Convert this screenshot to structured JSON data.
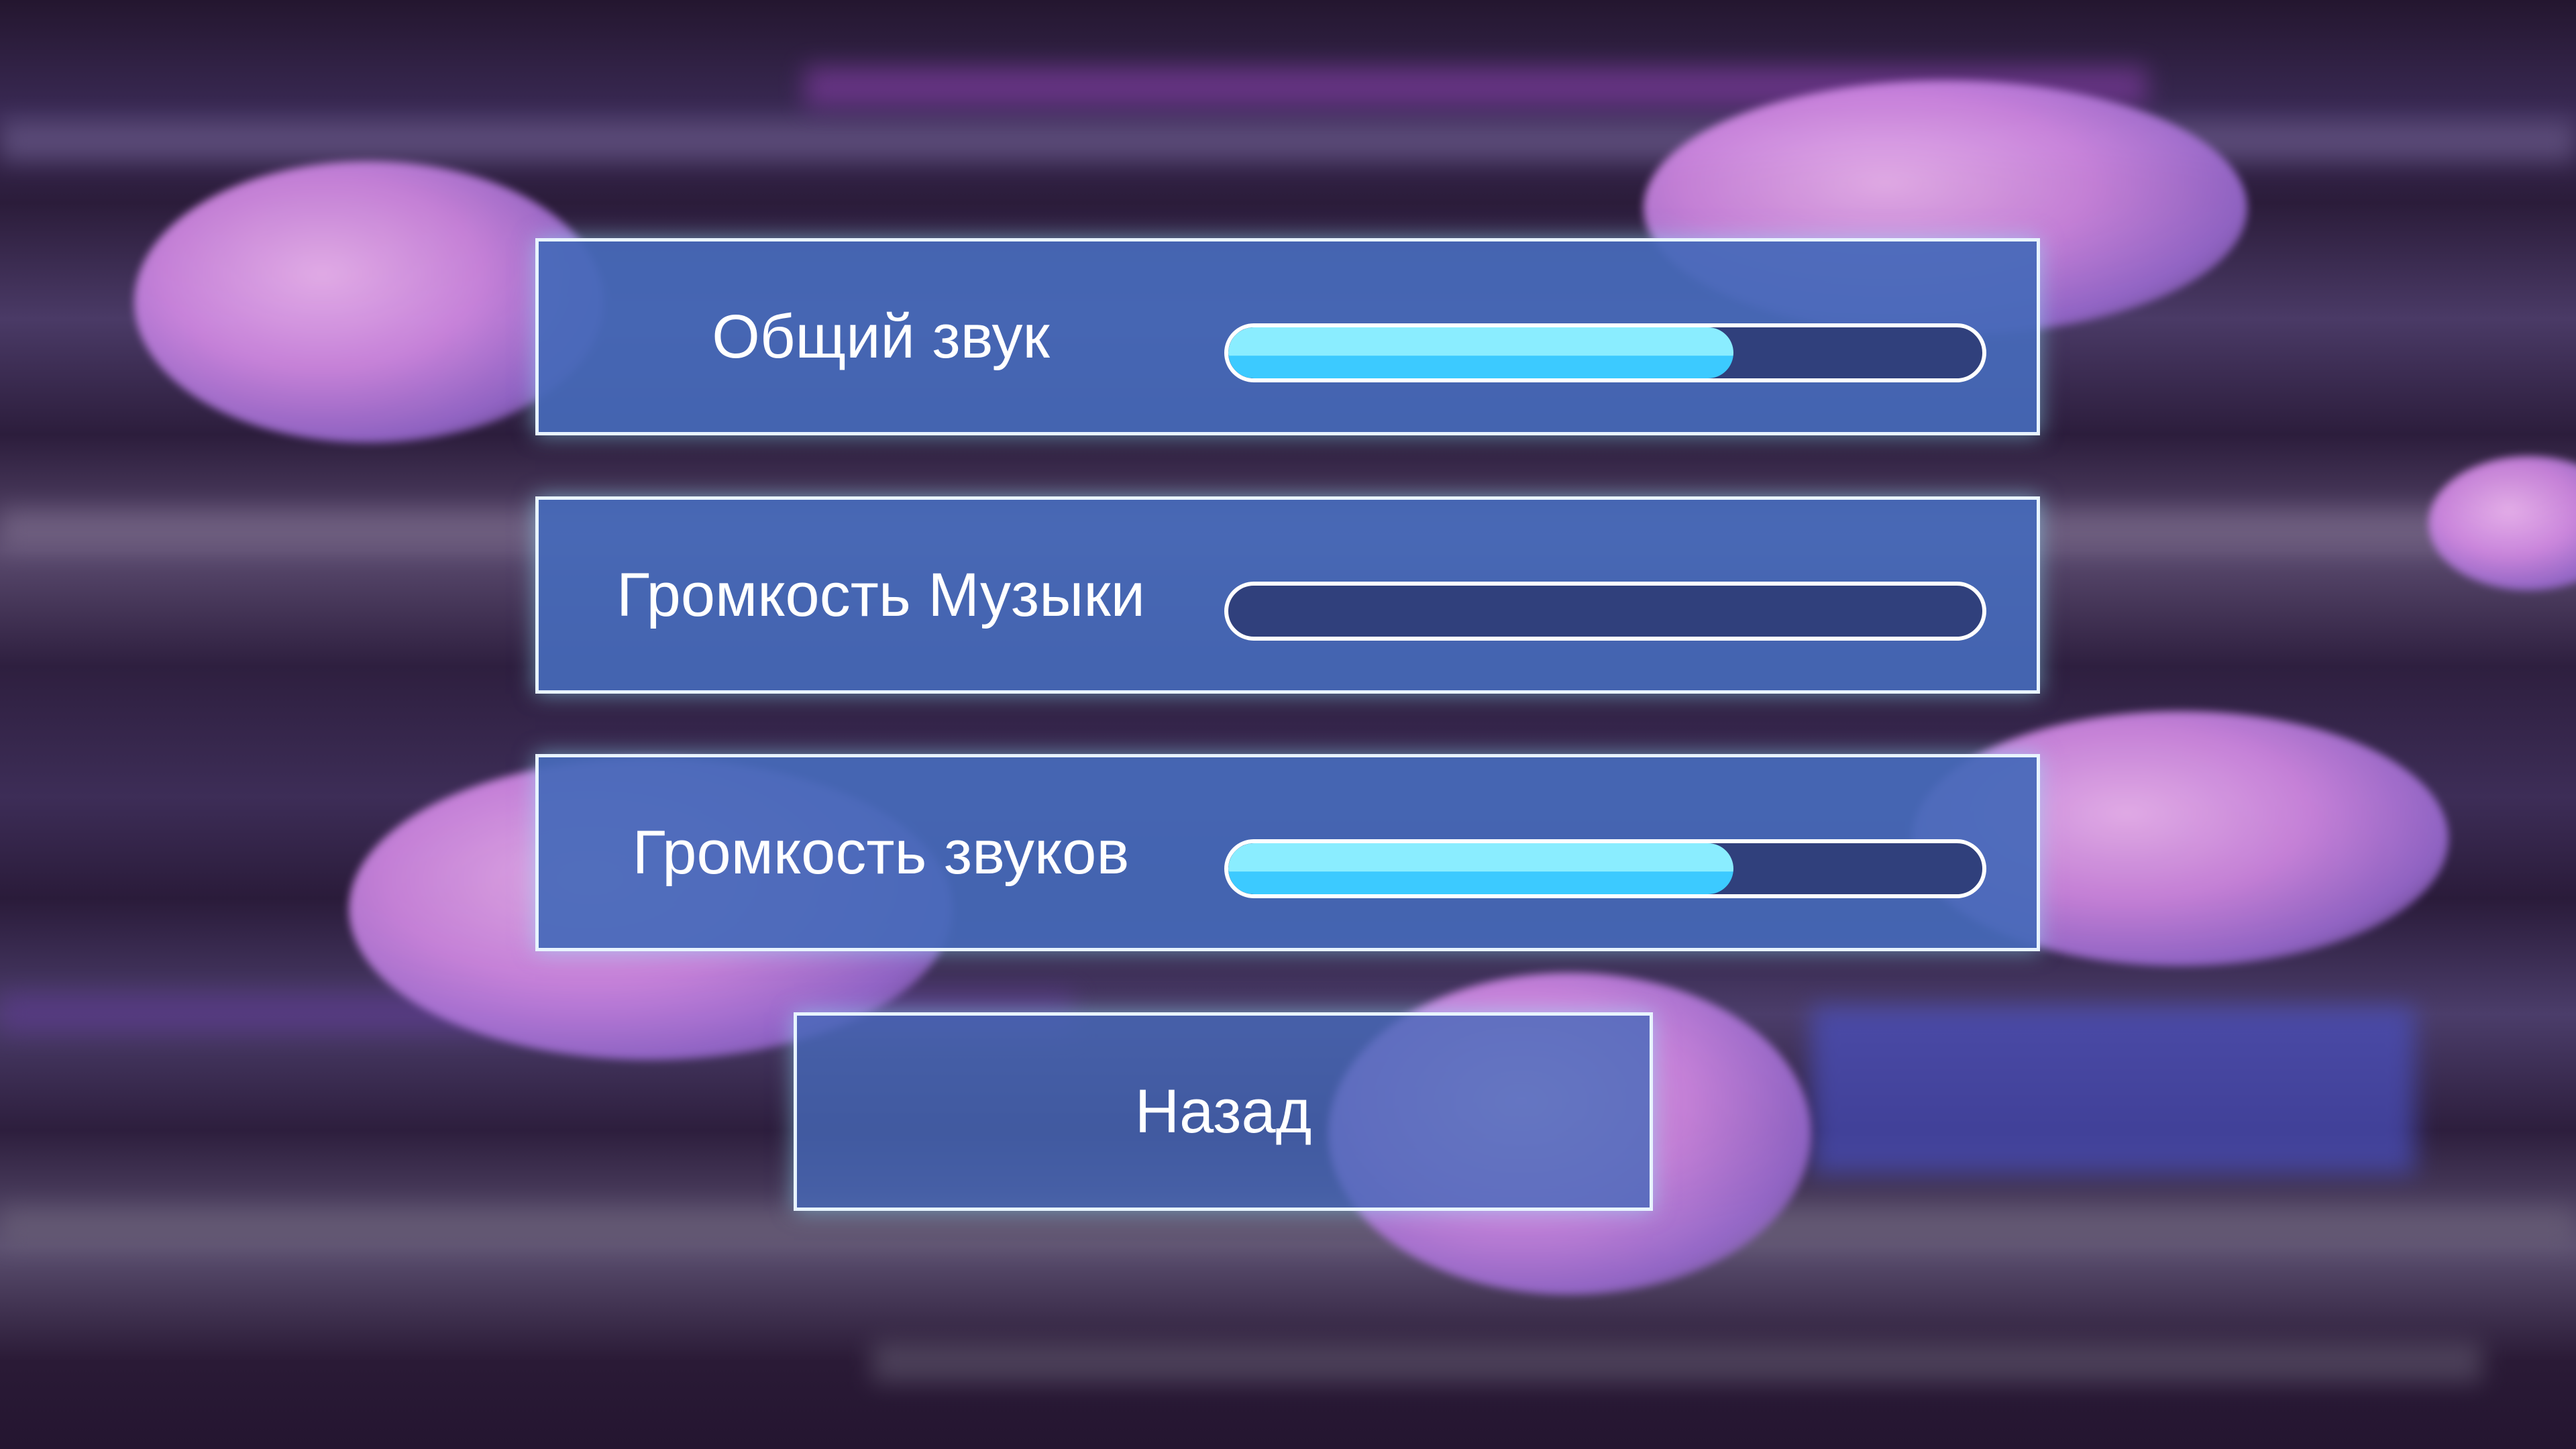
{
  "settings": [
    {
      "label": "Общий звук",
      "value": 0.67
    },
    {
      "label": "Громкость Музыки",
      "value": 0.0
    },
    {
      "label": "Громкость звуков",
      "value": 0.67
    }
  ],
  "back_label": "Назад",
  "colors": {
    "panel": "#4669b9",
    "track": "#30407c",
    "fill": "#3ccaff",
    "fill_highlight": "#8aedff",
    "background": "#2a1a38"
  }
}
